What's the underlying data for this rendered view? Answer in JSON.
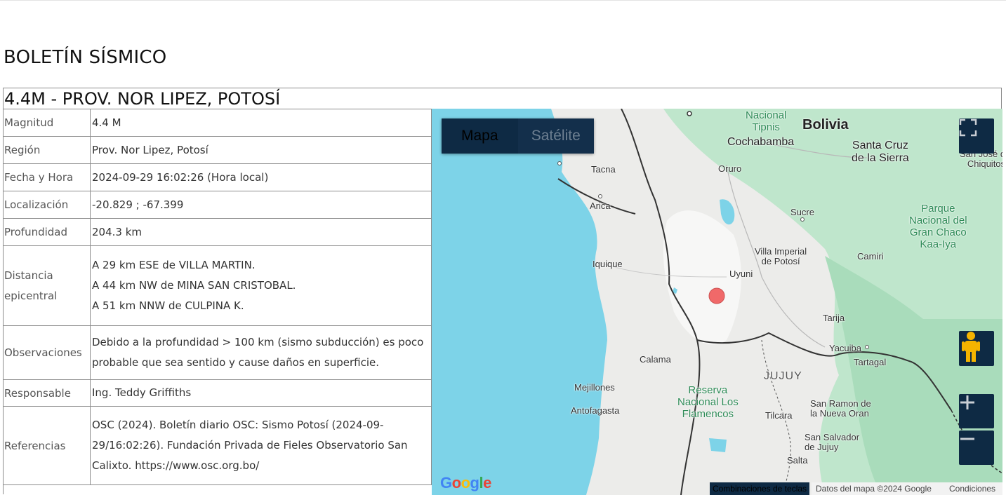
{
  "page": {
    "title": "BOLETÍN SÍSMICO"
  },
  "event": {
    "title": "4.4M - PROV. NOR LIPEZ, POTOSÍ",
    "rows": [
      {
        "label": "Magnitud",
        "value": "4.4 M"
      },
      {
        "label": "Región",
        "value": "Prov. Nor Lipez, Potosí"
      },
      {
        "label": "Fecha y Hora",
        "value": "2024-09-29 16:02:26 (Hora local)"
      },
      {
        "label": "Localización",
        "value": "-20.829 ; -67.399"
      },
      {
        "label": "Profundidad",
        "value": "204.3 km"
      }
    ],
    "distance": {
      "label": "Distancia epicentral",
      "lines": [
        "A 29 km ESE de VILLA MARTIN.",
        "A 44 km NW de MINA SAN CRISTOBAL.",
        "A 51 km NNW de CULPINA K."
      ]
    },
    "observations": {
      "label": "Observaciones",
      "value": "Debido a la profundidad > 100 km (sismo subducción) es poco probable que sea sentido y cause daños en superficie."
    },
    "responsible": {
      "label": "Responsable",
      "value": "Ing. Teddy Griffiths"
    },
    "references": {
      "label": "Referencias",
      "value": "OSC (2024). Boletín diario OSC: Sismo Potosí (2024-09-29/16:02:26). Fundación Privada de Fieles Observatorio San Calixto. https://www.osc.org.bo/"
    }
  },
  "map": {
    "type_map": "Mapa",
    "type_satellite": "Satélite",
    "labels": {
      "bolivia": "Bolivia",
      "cochabamba": "Cochabamba",
      "tipnis": "Nacional\nTipnis",
      "santa_cruz": "Santa Cruz\nde la Sierra",
      "san_jose": "San José d\nChiquitos",
      "tacna": "Tacna",
      "oruro": "Oruro",
      "arica": "Arica",
      "sucre": "Sucre",
      "parque": "Parque\nNacional del\nGran Chaco\nKaa-Iya",
      "villa_imperial": "Villa Imperial\nde Potosí",
      "camiri": "Camiri",
      "iquique": "Iquique",
      "uyuni": "Uyuni",
      "tarija": "Tarija",
      "yacuiba": "Yacuiba",
      "tartagal": "Tartagal",
      "calama": "Calama",
      "jujuy": "JUJUY",
      "mejillones": "Mejillones",
      "reserva": "Reserva\nNacional Los\nFlamencos",
      "antofagasta": "Antofagasta",
      "tilcara": "Tilcara",
      "san_ramon": "San Ramon de\nla Nueva Oran",
      "san_salvador": "San Salvador\nde Jujuy",
      "salta": "Salta"
    },
    "attribution": {
      "shortcuts": "Combinaciones de teclas",
      "data": "Datos del mapa ©2024 Google",
      "terms": "Condiciones"
    },
    "logo": "Google",
    "colors": {
      "ocean": "#7dd3e8",
      "land": "#ececea",
      "green": "#b7e3c6",
      "epicenter": "#f05a5a",
      "control": "#0e2a44"
    }
  }
}
